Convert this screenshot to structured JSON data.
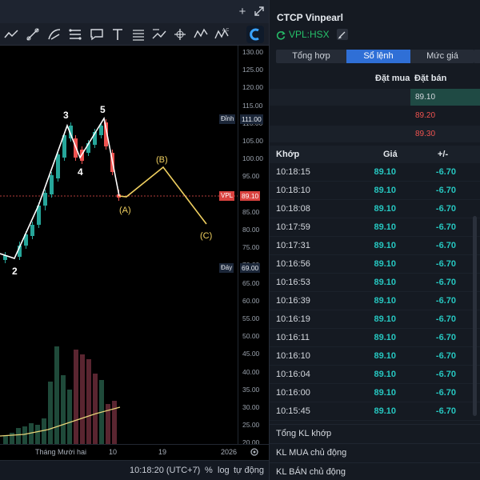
{
  "chart_toolbar": {
    "add_icon": "plus-icon",
    "expand_icon": "expand-icon",
    "tools": [
      "trend-line-icon",
      "ray-icon",
      "pitchfork-icon",
      "fib-icon",
      "comment-icon",
      "text-icon",
      "pattern-icon",
      "path-icon",
      "elliott-abc-icon",
      "elliott-abcd-icon",
      "logo-icon"
    ]
  },
  "price_axis": {
    "ticks": [
      "130.00",
      "125.00",
      "120.00",
      "115.00",
      "110.00",
      "105.00",
      "100.00",
      "95.00",
      "90.00",
      "85.00",
      "80.00",
      "75.00",
      "70.00",
      "65.00",
      "60.00",
      "55.00",
      "50.00",
      "45.00",
      "40.00",
      "35.00",
      "30.00",
      "25.00",
      "20.00"
    ],
    "peak_label": "Đỉnh",
    "peak_value": "111.00",
    "symbol_label": "VPL",
    "symbol_value": "89.10",
    "trough_label": "Đáy",
    "trough_value": "69.00"
  },
  "time_axis": {
    "labels": [
      "Tháng Mười hai",
      "10",
      "19",
      "2026"
    ]
  },
  "wave_labels": {
    "w2": "2",
    "w3": "3",
    "w4": "4",
    "w5": "5",
    "a": "(A)",
    "b": "(B)",
    "c": "(C)"
  },
  "chart_bottom": {
    "time": "10:18:20 (UTC+7)",
    "percent": "%",
    "log": "log",
    "auto": "tự động"
  },
  "colors": {
    "up": "#26a69a",
    "down": "#ef5350",
    "accent": "#2f6fd6",
    "teal": "#26c6c0",
    "wave": "#ffffff",
    "abc": "#f0d060"
  },
  "stock": {
    "title": "CTCP Vinpearl",
    "exchange": "VPL:HSX",
    "exchange_icon": "refresh-icon",
    "edit_icon": "pencil-icon"
  },
  "tabs": [
    {
      "label": "Tổng hợp",
      "active": false
    },
    {
      "label": "Sổ lệnh",
      "active": true
    },
    {
      "label": "Mức giá",
      "active": false
    }
  ],
  "order_book": {
    "buy_header": "Đặt mua",
    "sell_header": "Đặt bán",
    "rows": [
      {
        "buy": "",
        "sell": "89.10",
        "sell_color": "#26c6c0"
      },
      {
        "buy": "",
        "sell": "89.20",
        "sell_color": "#ef5350"
      },
      {
        "buy": "",
        "sell": "89.30",
        "sell_color": "#ef5350"
      }
    ]
  },
  "trades": {
    "headers": {
      "time": "Khớp",
      "price": "Giá",
      "change": "+/-"
    },
    "rows": [
      {
        "time": "10:18:15",
        "price": "89.10",
        "change": "-6.70"
      },
      {
        "time": "10:18:10",
        "price": "89.10",
        "change": "-6.70"
      },
      {
        "time": "10:18:08",
        "price": "89.10",
        "change": "-6.70"
      },
      {
        "time": "10:17:59",
        "price": "89.10",
        "change": "-6.70"
      },
      {
        "time": "10:17:31",
        "price": "89.10",
        "change": "-6.70"
      },
      {
        "time": "10:16:56",
        "price": "89.10",
        "change": "-6.70"
      },
      {
        "time": "10:16:53",
        "price": "89.10",
        "change": "-6.70"
      },
      {
        "time": "10:16:39",
        "price": "89.10",
        "change": "-6.70"
      },
      {
        "time": "10:16:19",
        "price": "89.10",
        "change": "-6.70"
      },
      {
        "time": "10:16:11",
        "price": "89.10",
        "change": "-6.70"
      },
      {
        "time": "10:16:10",
        "price": "89.10",
        "change": "-6.70"
      },
      {
        "time": "10:16:04",
        "price": "89.10",
        "change": "-6.70"
      },
      {
        "time": "10:16:00",
        "price": "89.10",
        "change": "-6.70"
      },
      {
        "time": "10:15:45",
        "price": "89.10",
        "change": "-6.70"
      }
    ]
  },
  "summary": {
    "total_volume": "Tổng KL khớp",
    "active_buy": "KL MUA chủ động",
    "active_sell": "KL BÁN chủ động"
  }
}
